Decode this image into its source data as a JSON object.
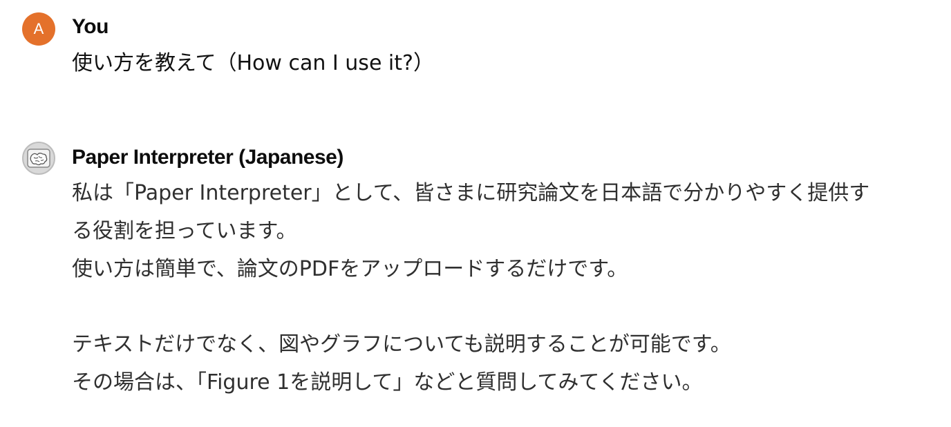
{
  "messages": [
    {
      "role": "user",
      "avatar_letter": "A",
      "author": "You",
      "text": "使い方を教えて（How can I use it?）"
    },
    {
      "role": "assistant",
      "avatar_icon": "brain-icon",
      "author": "Paper Interpreter (Japanese)",
      "lines": [
        "私は「Paper Interpreter」として、皆さまに研究論文を日本語で分かりやすく提供す",
        "る役割を担っています。",
        "使い方は簡単で、論文のPDFをアップロードするだけです。",
        "テキストだけでなく、図やグラフについても説明することが可能です。",
        "その場合は、「Figure 1を説明して」などと質問してみてください。"
      ]
    }
  ],
  "colors": {
    "user_avatar_bg": "#e4712b",
    "assistant_avatar_bg": "#d9d9d9",
    "text": "#2f2f2f",
    "author": "#0d0d0d"
  }
}
